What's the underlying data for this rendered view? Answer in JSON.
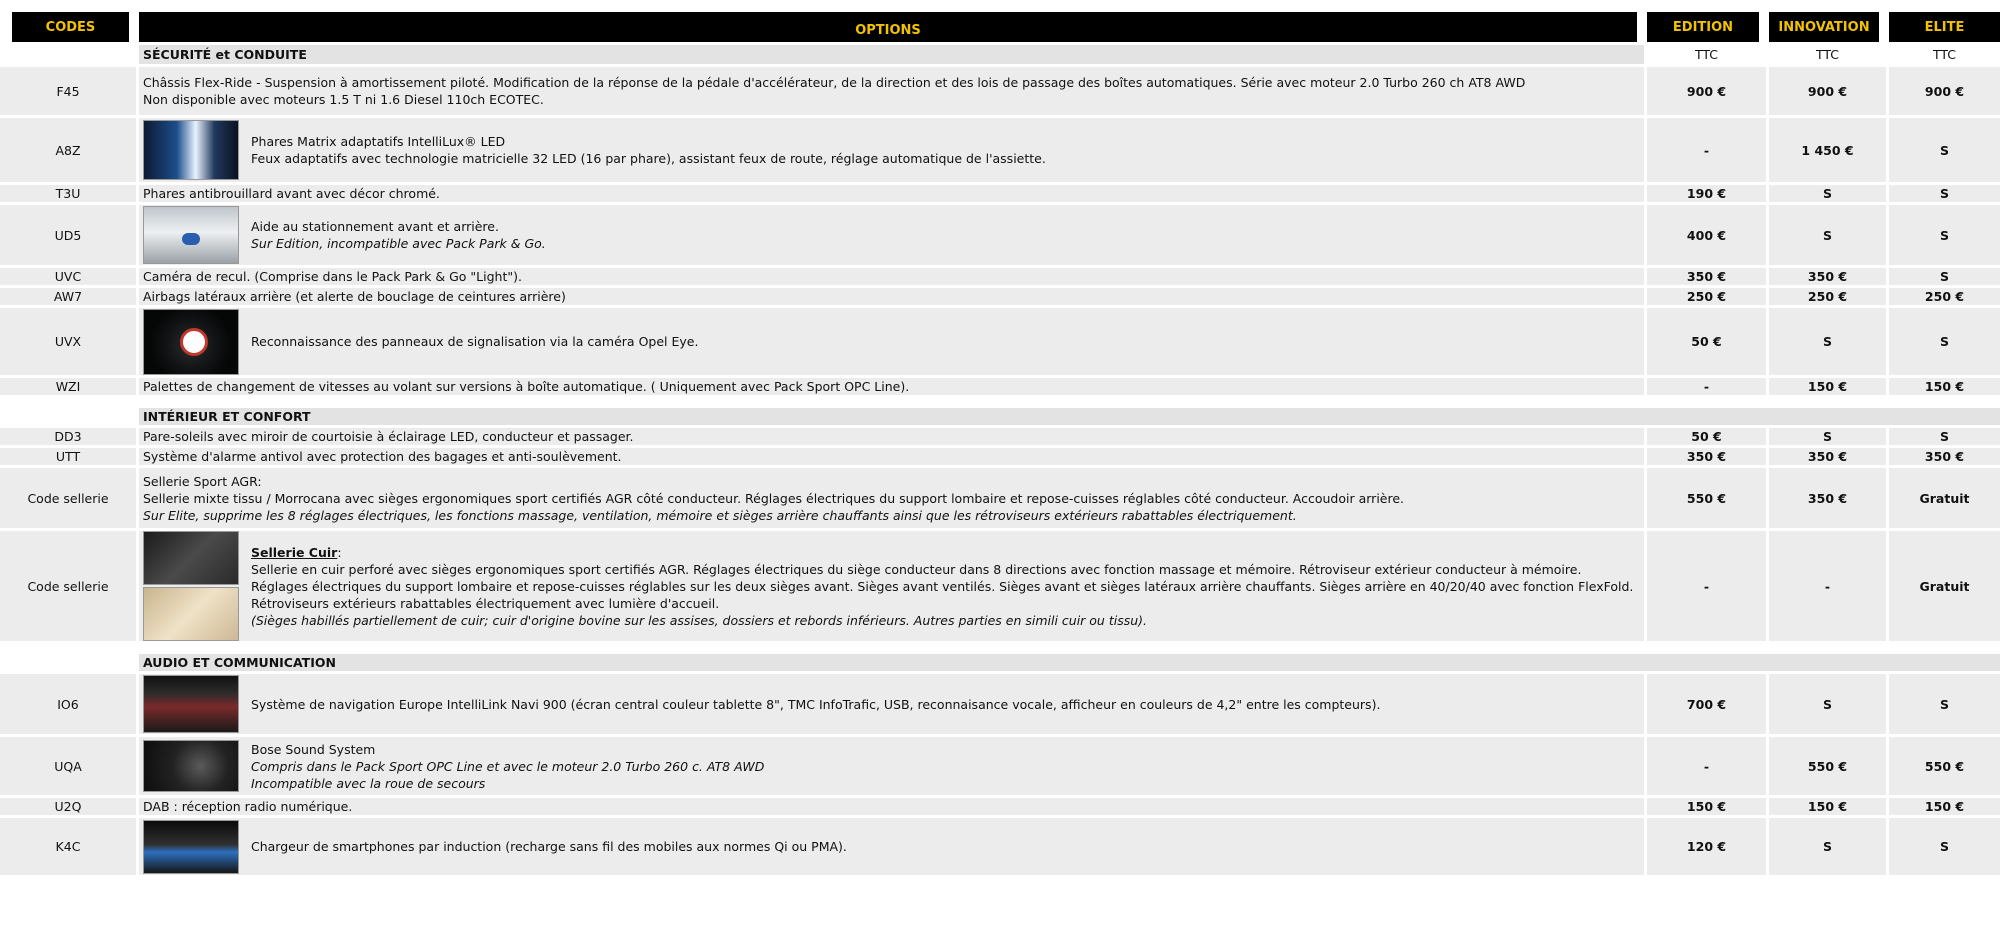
{
  "headers": {
    "codes": "CODES",
    "options": "OPTIONS",
    "edition": "EDITION",
    "innovation": "INNOVATION",
    "elite": "ELITE"
  },
  "ttc": "TTC",
  "sections": {
    "securite": "SÉCURITÉ et CONDUITE",
    "interieur": "INTÉRIEUR ET CONFORT",
    "audio": "AUDIO ET COMMUNICATION"
  },
  "rows": [
    {
      "code": "F45",
      "lines": [
        "Châssis Flex-Ride - Suspension à amortissement piloté. Modification de la réponse de la pédale d'accélérateur, de la direction et des lois de passage des boîtes automatiques. Série avec moteur 2.0 Turbo 260 ch AT8 AWD",
        "Non disponible avec moteurs 1.5 T ni 1.6 Diesel 110ch ECOTEC."
      ],
      "edition": "900 €",
      "innovation": "900 €",
      "elite": "900 €"
    },
    {
      "code": "A8Z",
      "image": "headlight-photo",
      "lines": [
        "Phares Matrix adaptatifs IntelliLux® LED",
        "Feux adaptatifs avec technologie matricielle 32 LED (16 par phare), assistant feux de route, réglage automatique de l'assiette."
      ],
      "edition": "-",
      "innovation": "1 450 €",
      "elite": "S"
    },
    {
      "code": "T3U",
      "lines": [
        "Phares antibrouillard avant avec décor chromé."
      ],
      "edition": "190 €",
      "innovation": "S",
      "elite": "S"
    },
    {
      "code": "UD5",
      "image": "parking-sensor-photo",
      "lines": [
        "Aide au stationnement avant et arrière."
      ],
      "italic": [
        "Sur Edition, incompatible avec Pack Park & Go."
      ],
      "edition": "400 €",
      "innovation": "S",
      "elite": "S"
    },
    {
      "code": "UVC",
      "lines": [
        "Caméra de recul. (Comprise dans le Pack Park & Go \"Light\")."
      ],
      "edition": "350 €",
      "innovation": "350 €",
      "elite": "S"
    },
    {
      "code": "AW7",
      "lines": [
        "Airbags latéraux arrière (et alerte de bouclage de ceintures arrière)"
      ],
      "edition": "250 €",
      "innovation": "250 €",
      "elite": "250 €"
    },
    {
      "code": "UVX",
      "image": "dashboard-gauge-photo",
      "lines": [
        "Reconnaissance des panneaux de signalisation via la caméra Opel Eye."
      ],
      "edition": "50 €",
      "innovation": "S",
      "elite": "S"
    },
    {
      "code": "WZI",
      "lines": [
        "Palettes de changement de vitesses au volant sur versions à boîte automatique. ( Uniquement avec Pack Sport OPC Line)."
      ],
      "edition": "-",
      "innovation": "150 €",
      "elite": "150 €"
    },
    {
      "code": "DD3",
      "lines": [
        "Pare-soleils avec miroir de courtoisie à éclairage LED, conducteur et passager."
      ],
      "edition": "50 €",
      "innovation": "S",
      "elite": "S"
    },
    {
      "code": "UTT",
      "lines": [
        "Système d'alarme antivol avec protection des bagages et anti-soulèvement."
      ],
      "edition": "350 €",
      "innovation": "350 €",
      "elite": "350 €"
    },
    {
      "code": "Code sellerie",
      "lines": [
        "Sellerie Sport AGR:",
        "Sellerie mixte tissu / Morrocana avec sièges ergonomiques sport certifiés AGR côté conducteur.  Réglages électriques du support lombaire et repose-cuisses réglables côté conducteur. Accoudoir arrière."
      ],
      "italic": [
        "Sur Elite, supprime les 8 réglages électriques, les fonctions massage, ventilation, mémoire et sièges arrière chauffants ainsi que les rétroviseurs extérieurs rabattables électriquement."
      ],
      "edition": "550 €",
      "innovation": "350 €",
      "elite": "Gratuit"
    },
    {
      "code": "Code sellerie",
      "image": "leather-seat-photos",
      "title": "Sellerie Cuir",
      "lines": [
        "Sellerie en cuir perforé avec sièges ergonomiques sport certifiés AGR. Réglages électriques du siège conducteur dans 8 directions avec fonction massage et mémoire. Rétroviseur extérieur conducteur à mémoire. Réglages électriques du support lombaire et repose-cuisses réglables sur les deux sièges avant. Sièges avant ventilés. Sièges avant et sièges latéraux arrière chauffants. Sièges arrière en 40/20/40 avec fonction FlexFold. Rétroviseurs extérieurs rabattables électriquement avec lumière d'accueil."
      ],
      "italic": [
        "(Sièges habillés partiellement de cuir; cuir d'origine bovine sur les assises, dossiers et rebords inférieurs. Autres parties en simili cuir ou tissu)."
      ],
      "edition": "-",
      "innovation": "-",
      "elite": "Gratuit"
    },
    {
      "code": "IO6",
      "image": "navigation-screen-photo",
      "lines": [
        "Système de navigation Europe IntelliLink Navi 900 (écran central couleur tablette 8\",  TMC InfoTrafic, USB, reconnaisance vocale, afficheur en couleurs de 4,2\" entre les compteurs)."
      ],
      "edition": "700 €",
      "innovation": "S",
      "elite": "S"
    },
    {
      "code": "UQA",
      "image": "bose-speaker-photo",
      "lines": [
        "Bose Sound System"
      ],
      "italic": [
        "Compris dans le Pack Sport OPC Line et avec le moteur 2.0 Turbo 260 c. AT8 AWD",
        "Incompatible avec la roue de secours"
      ],
      "edition": "-",
      "innovation": "550 €",
      "elite": "550 €"
    },
    {
      "code": "U2Q",
      "lines": [
        "DAB : réception radio numérique."
      ],
      "edition": "150 €",
      "innovation": "150 €",
      "elite": "150 €"
    },
    {
      "code": "K4C",
      "image": "wireless-charger-photo",
      "lines": [
        "Chargeur de smartphones par induction (recharge sans fil des mobiles aux normes Qi ou PMA)."
      ],
      "edition": "120 €",
      "innovation": "S",
      "elite": "S"
    }
  ]
}
